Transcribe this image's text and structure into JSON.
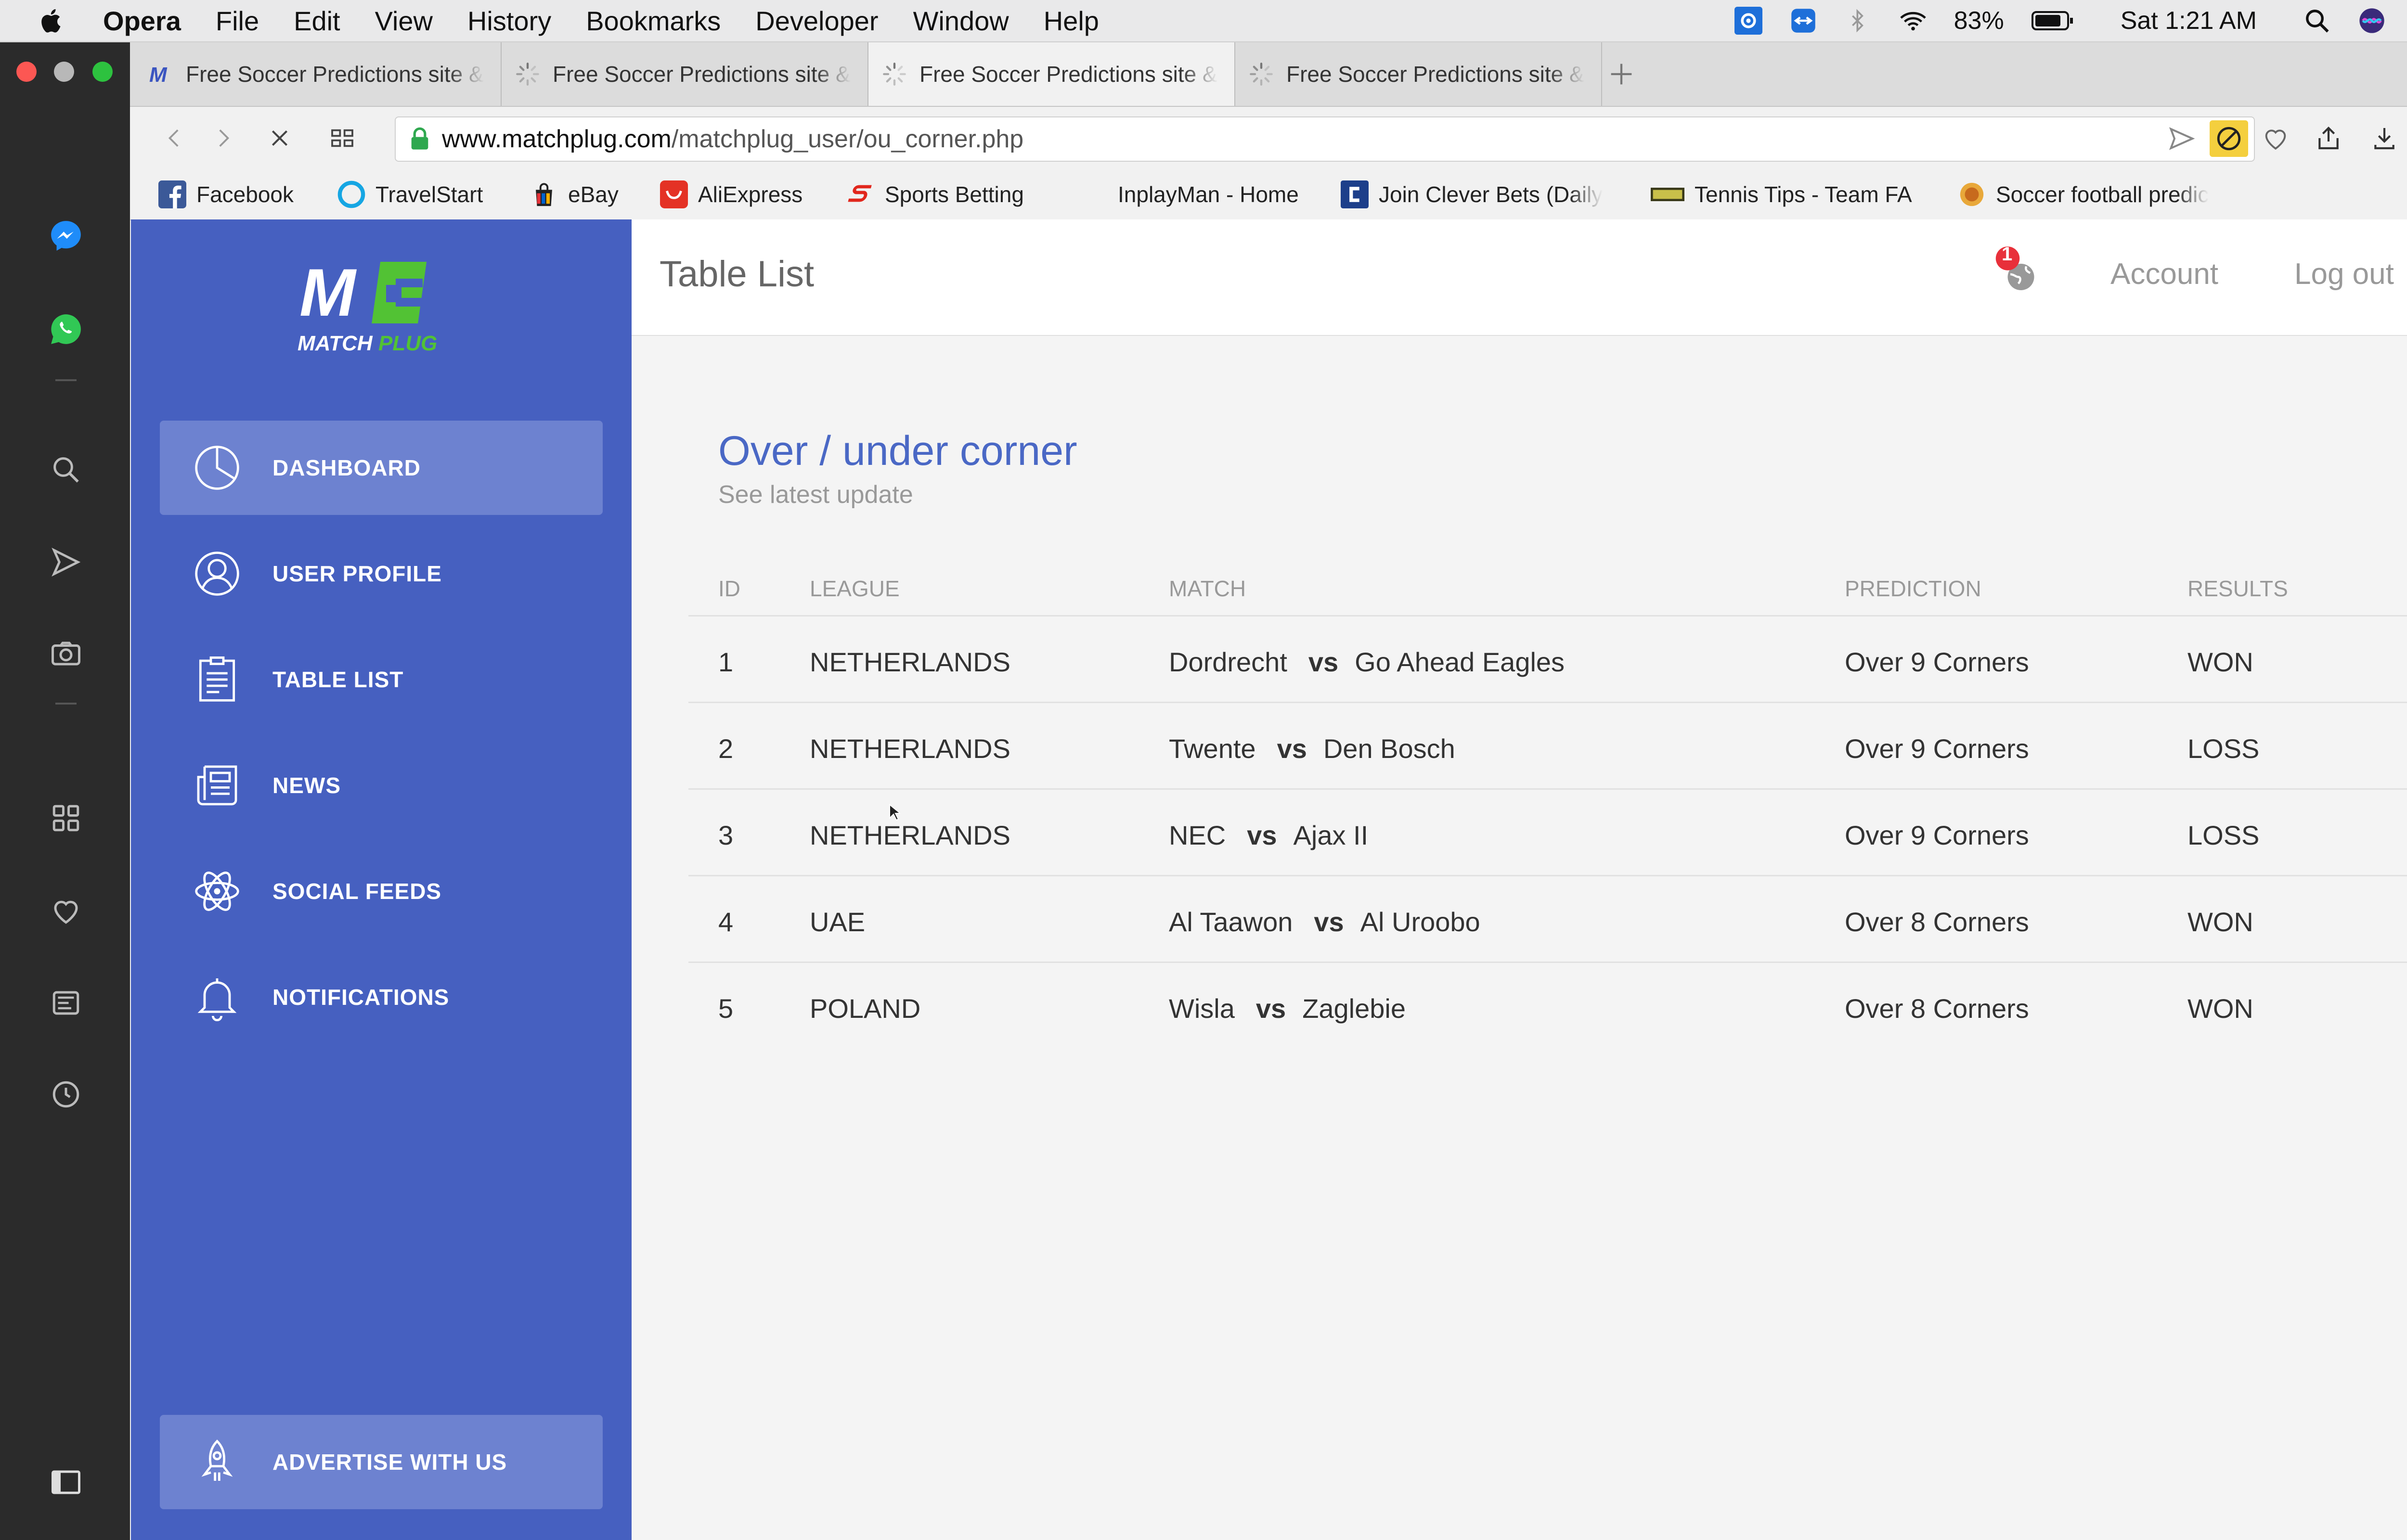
{
  "menubar": {
    "app_name": "Opera",
    "menus": [
      "File",
      "Edit",
      "View",
      "History",
      "Bookmarks",
      "Developer",
      "Window",
      "Help"
    ],
    "battery": "83%",
    "clock": "Sat 1:21 AM"
  },
  "tabs": [
    {
      "title": "Free Soccer Predictions site & more",
      "icon": "matchplug-favicon",
      "active": false
    },
    {
      "title": "Free Soccer Predictions site & more",
      "icon": "loading-spinner",
      "active": false
    },
    {
      "title": "Free Soccer Predictions site & more",
      "icon": "loading-spinner",
      "active": true
    },
    {
      "title": "Free Soccer Predictions site & more",
      "icon": "loading-spinner",
      "active": false
    }
  ],
  "address": {
    "domain": "www.matchplug.com",
    "path": "/matchplug_user/ou_corner.php"
  },
  "bookmarks": [
    {
      "label": "Facebook",
      "icon": "facebook-icon"
    },
    {
      "label": "TravelStart",
      "icon": "travelstart-icon"
    },
    {
      "label": "eBay",
      "icon": "ebay-icon"
    },
    {
      "label": "AliExpress",
      "icon": "aliexpress-icon"
    },
    {
      "label": "Sports Betting",
      "icon": "sports-betting-icon"
    },
    {
      "label": "InplayMan - Home",
      "icon": ""
    },
    {
      "label": "Join Clever Bets (Daily",
      "icon": "cleverbets-icon"
    },
    {
      "label": "Tennis Tips - Team FA",
      "icon": "tennis-icon"
    },
    {
      "label": "Soccer football predic",
      "icon": "soccer-icon"
    }
  ],
  "brand": {
    "logo_text": "MATCHPLUG",
    "accent": "#52c234",
    "sidebar_bg": "#4660c0"
  },
  "sidebar": {
    "items": [
      {
        "label": "DASHBOARD",
        "icon": "pie-chart-icon",
        "active": true
      },
      {
        "label": "USER PROFILE",
        "icon": "user-icon",
        "active": false
      },
      {
        "label": "TABLE LIST",
        "icon": "clipboard-icon",
        "active": false
      },
      {
        "label": "NEWS",
        "icon": "newspaper-icon",
        "active": false
      },
      {
        "label": "SOCIAL FEEDS",
        "icon": "atom-icon",
        "active": false
      },
      {
        "label": "NOTIFICATIONS",
        "icon": "bell-icon",
        "active": false
      }
    ],
    "advertise": {
      "label": "ADVERTISE WITH US",
      "icon": "rocket-icon"
    }
  },
  "header": {
    "title": "Table List",
    "notification_count": "1",
    "account": "Account",
    "logout": "Log out"
  },
  "card": {
    "title": "Over / under corner",
    "subtitle": "See latest update",
    "columns": [
      "ID",
      "LEAGUE",
      "MATCH",
      "PREDICTION",
      "RESULTS"
    ],
    "rows": [
      {
        "id": "1",
        "league": "NETHERLANDS",
        "home": "Dordrecht",
        "vs": "vs",
        "away": "Go Ahead Eagles",
        "prediction": "Over 9 Corners",
        "result": "WON"
      },
      {
        "id": "2",
        "league": "NETHERLANDS",
        "home": "Twente",
        "vs": "vs",
        "away": "Den Bosch",
        "prediction": "Over 9 Corners",
        "result": "LOSS"
      },
      {
        "id": "3",
        "league": "NETHERLANDS",
        "home": "NEC",
        "vs": "vs",
        "away": "Ajax II",
        "prediction": "Over 9 Corners",
        "result": "LOSS"
      },
      {
        "id": "4",
        "league": "UAE",
        "home": "Al Taawon",
        "vs": "vs",
        "away": "Al Uroobo",
        "prediction": "Over 8 Corners",
        "result": "WON"
      },
      {
        "id": "5",
        "league": "POLAND",
        "home": "Wisla",
        "vs": "vs",
        "away": "Zaglebie",
        "prediction": "Over 8 Corners",
        "result": "WON"
      }
    ]
  }
}
